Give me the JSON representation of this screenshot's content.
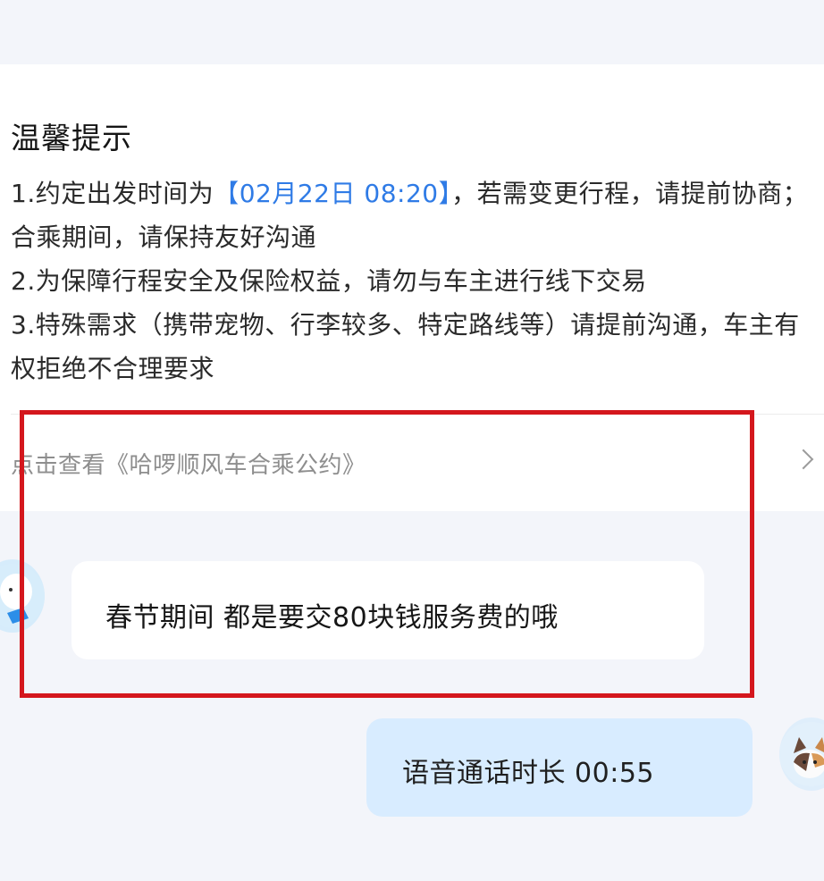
{
  "notice": {
    "title": "温馨提示",
    "line1_prefix": "1.约定出发时间为",
    "line1_time": "【02月22日 08:20】",
    "line1_suffix": "，若需变更行程，请提前协商；合乘期间，请保持友好沟通",
    "line2": "2.为保障行程安全及保险权益，请勿与车主进行线下交易",
    "line3": "3.特殊需求（携带宠物、行李较多、特定路线等）请提前沟通，车主有权拒绝不合理要求"
  },
  "pact_link": "点击查看《哈啰顺风车合乘公约》",
  "messages": {
    "incoming": "春节期间 都是要交80块钱服务费的哦",
    "outgoing": "语音通话时长  00:55"
  },
  "colors": {
    "highlight_box": "#d4171d",
    "time_highlight": "#2f7be6",
    "outgoing_bubble": "#d8ecff"
  }
}
